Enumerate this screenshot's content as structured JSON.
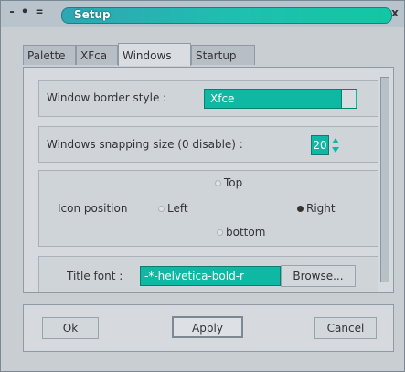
{
  "window": {
    "title": "Setup",
    "controls": {
      "menu": "-",
      "shade": "•",
      "maximize": "=",
      "close": "x"
    }
  },
  "tabs": [
    {
      "label": "Palette"
    },
    {
      "label": "XFca"
    },
    {
      "label": "Windows",
      "active": true
    },
    {
      "label": "Startup"
    }
  ],
  "windows_tab": {
    "border_style_label": "Window border style :",
    "border_style_value": "Xfce",
    "snapping_label": "Windows snapping size (0 disable) :",
    "snapping_value": "20",
    "icon_position_label": "Icon position",
    "icon_position_options": {
      "top": "Top",
      "left": "Left",
      "right": "Right",
      "bottom": "bottom"
    },
    "icon_position_selected": "Right",
    "title_font_label": "Title font :",
    "title_font_value": "-*-helvetica-bold-r",
    "browse_label": "Browse..."
  },
  "buttons": {
    "ok": "Ok",
    "apply": "Apply",
    "cancel": "Cancel"
  },
  "colors": {
    "accent": "#0fb8a2",
    "title_gradient_end": "#12c7a2",
    "background": "#c9ced3"
  }
}
